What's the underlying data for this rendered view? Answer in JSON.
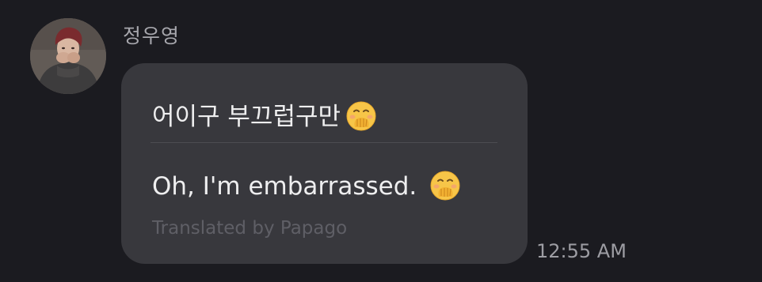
{
  "conversation": {
    "sender": {
      "name": "정우영",
      "avatar_icon": "profile-photo"
    },
    "message": {
      "original_text": "어이구 부끄럽구만",
      "translated_text": "Oh, I'm embarrassed.",
      "translation_credit": "Translated by Papago",
      "emoji_icon": "face-with-hand-over-mouth-emoji",
      "timestamp": "12:55 AM"
    }
  },
  "colors": {
    "background": "#1b1b20",
    "bubble": "#38383d",
    "text_primary": "#eeeeef",
    "text_secondary": "#a7a7ad",
    "credit_text": "#5f5f66"
  }
}
